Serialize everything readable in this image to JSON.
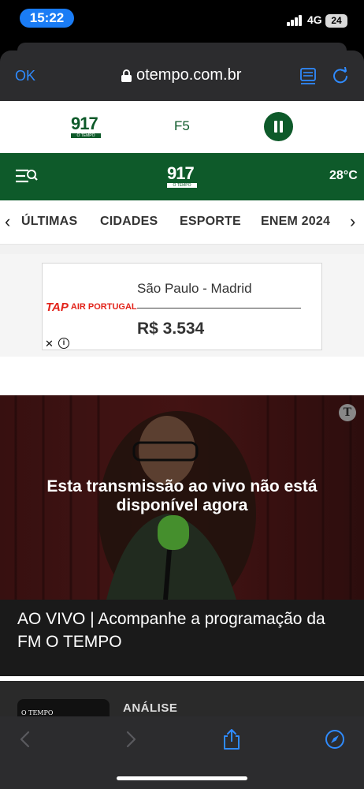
{
  "status_bar": {
    "time": "15:22",
    "network": "4G",
    "battery": "24"
  },
  "browser": {
    "done_label": "OK",
    "url": "otempo.com.br",
    "accent_color": "#2f8bff"
  },
  "radio_player": {
    "logo_number": "917",
    "logo_sub": "O TEMPO",
    "station": "F5",
    "brand_color": "#0e5a2a"
  },
  "site_header": {
    "logo_number": "917",
    "logo_sub": "O TEMPO",
    "temperature": "28°C"
  },
  "nav": {
    "items": [
      "ÚLTIMAS",
      "CIDADES",
      "ESPORTE",
      "ENEM 2024"
    ]
  },
  "ad": {
    "brand_mark": "TAP",
    "brand_name": "AIR PORTUGAL",
    "route": "São Paulo - Madrid",
    "price": "R$ 3.534"
  },
  "video": {
    "badge": "T",
    "message": "Esta transmissão ao vivo não está disponível agora"
  },
  "live_title": "AO VIVO | Acompanhe a programação da FM O TEMPO",
  "next_article": {
    "thumb_tag": "O TEMPO",
    "category": "ANÁLISE"
  },
  "icons": {
    "reader": "reader-icon",
    "reload": "reload-icon",
    "menu_search": "menu-search-icon",
    "back": "back-icon",
    "forward": "forward-icon",
    "share": "share-icon",
    "compass": "compass-icon"
  }
}
